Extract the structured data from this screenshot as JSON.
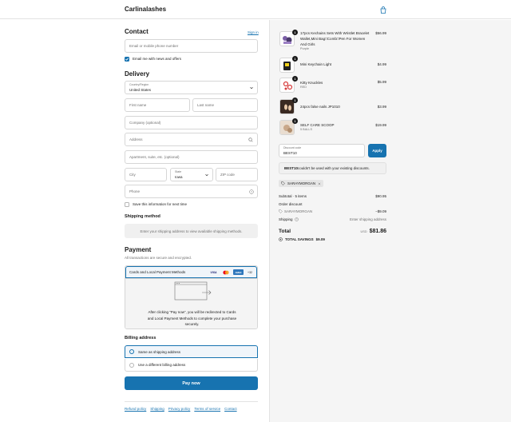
{
  "header": {
    "brand": "Carlinalashes",
    "cart_icon": "shopping-bag-icon"
  },
  "contact": {
    "title": "Contact",
    "sign_in": "Sign in",
    "email_placeholder": "Email or mobile phone number",
    "newsletter_label": "Email me with news and offers",
    "newsletter_checked": true
  },
  "delivery": {
    "title": "Delivery",
    "country_label": "Country/Region",
    "country_value": "United States",
    "first_name_placeholder": "First name",
    "last_name_placeholder": "Last name",
    "company_placeholder": "Company (optional)",
    "address_placeholder": "Address",
    "apartment_placeholder": "Apartment, suite, etc. (optional)",
    "city_placeholder": "City",
    "state_label": "State",
    "state_value": "Iowa",
    "zip_placeholder": "ZIP code",
    "phone_placeholder": "Phone",
    "save_info_label": "Save this information for next time",
    "save_info_checked": false
  },
  "shipping_method": {
    "title": "Shipping method",
    "notice": "Enter your shipping address to view available shipping methods."
  },
  "payment": {
    "title": "Payment",
    "subtitle": "All transactions are secure and encrypted.",
    "method_label": "Cards and Local Payment Methods",
    "card_brands": [
      "VISA",
      "",
      "AMEX"
    ],
    "more_cards": "+32",
    "redirect_text": "After clicking “Pay now”, you will be redirected to Cards and Local Payment Methods to complete your purchase securely."
  },
  "billing": {
    "title": "Billing address",
    "options": [
      {
        "label": "Same as shipping address",
        "selected": true
      },
      {
        "label": "Use a different billing address",
        "selected": false
      }
    ]
  },
  "pay_button": "Pay now",
  "footer_links": [
    "Refund policy",
    "Shipping",
    "Privacy policy",
    "Terms of service",
    "Contact"
  ],
  "cart": {
    "items": [
      {
        "name": "17pcs Kechains Sets With Wristlet Bracelet Wallet,Mini Bag□Comb□Pen For Women And Girls",
        "variant": "Purple",
        "qty": "1",
        "price": "$56.99"
      },
      {
        "name": "Mini Keychain Light",
        "variant": "",
        "qty": "1",
        "price": "$4.99"
      },
      {
        "name": "Kitty Knuckles",
        "variant": "RED",
        "qty": "1",
        "price": "$5.99"
      },
      {
        "name": "24pcs false nails JP1010",
        "variant": "",
        "qty": "1",
        "price": "$3.99"
      },
      {
        "name": "SELF CARE SCOOP",
        "variant": "5 BALLS",
        "qty": "1",
        "price": "$19.99"
      }
    ],
    "discount_label": "Discount code",
    "discount_value": "BEST10",
    "apply_button": "Apply",
    "discount_error_code": "BEST10",
    "discount_error_text": " couldn't be used with your existing discounts.",
    "applied_tag": "SARAYMORGAN",
    "subtotal_label": "Subtotal · 5 items",
    "subtotal_value": "$90.95",
    "order_discount_label": "Order discount",
    "order_discount_code": "SARAYMORGAN",
    "order_discount_value": "−$9.09",
    "shipping_label": "Shipping",
    "shipping_value": "Enter shipping address",
    "total_label": "Total",
    "currency": "USD",
    "total_value": "$81.86",
    "total_savings_label": "TOTAL SAVINGS",
    "total_savings_value": "$9.09"
  },
  "colors": {
    "accent": "#1773b0",
    "text": "#1a1a1a",
    "muted": "#707070",
    "panel": "#f5f5f5"
  }
}
